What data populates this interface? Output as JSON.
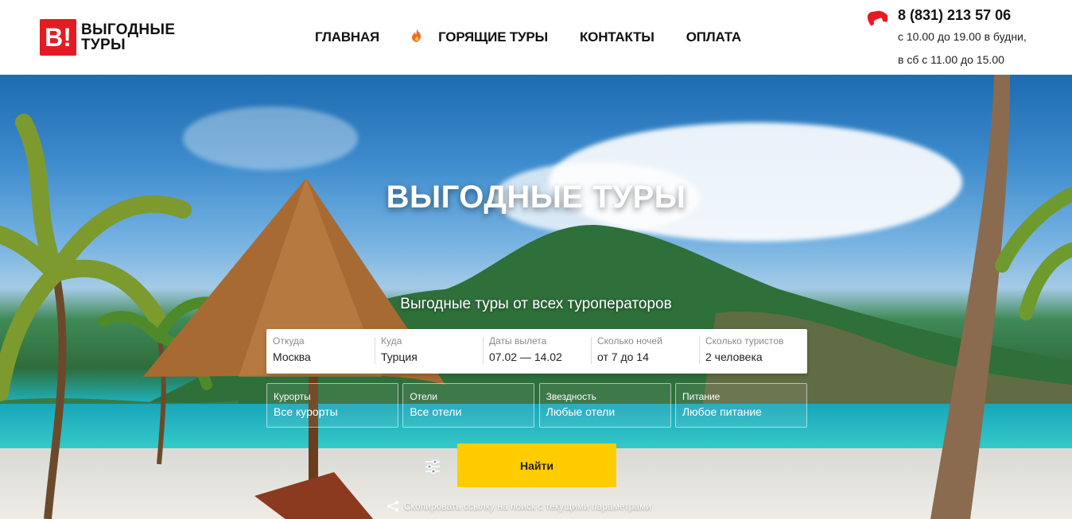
{
  "logo": {
    "mark": "B!",
    "line1": "ВЫГОДНЫЕ",
    "line2": "ТУРЫ"
  },
  "nav": {
    "items": [
      {
        "label": "ГЛАВНАЯ"
      },
      {
        "label": "ГОРЯЩИЕ ТУРЫ",
        "icon": "fire-icon"
      },
      {
        "label": "КОНТАКТЫ"
      },
      {
        "label": "ОПЛАТА"
      }
    ]
  },
  "contacts": {
    "phone": "8 (831) 213 57 06",
    "hours_weekdays": "с 10.00 до 19.00 в будни,",
    "hours_saturday": "в сб с 11.00 до 15.00"
  },
  "hero": {
    "title": "ВЫГОДНЫЕ ТУРЫ",
    "subtitle": "Выгодные туры от всех туроператоров"
  },
  "search": {
    "main_fields": [
      {
        "label": "Откуда",
        "value": "Москва"
      },
      {
        "label": "Куда",
        "value": "Турция"
      },
      {
        "label": "Даты вылета",
        "value": "07.02 — 14.02"
      },
      {
        "label": "Сколько ночей",
        "value": "от 7 до 14"
      },
      {
        "label": "Сколько туристов",
        "value": "2 человека"
      }
    ],
    "extra_fields": [
      {
        "label": "Курорты",
        "value": "Все курорты"
      },
      {
        "label": "Отели",
        "value": "Все отели"
      },
      {
        "label": "Звездность",
        "value": "Любые отели"
      },
      {
        "label": "Питание",
        "value": "Любое питание"
      }
    ],
    "find_button": "Найти",
    "copy_link": "Скопировать ссылку на поиск с текущими параметрами"
  },
  "colors": {
    "brand_red": "#e51a22",
    "button_yellow": "#ffcc00",
    "fire_orange": "#f26a21"
  }
}
